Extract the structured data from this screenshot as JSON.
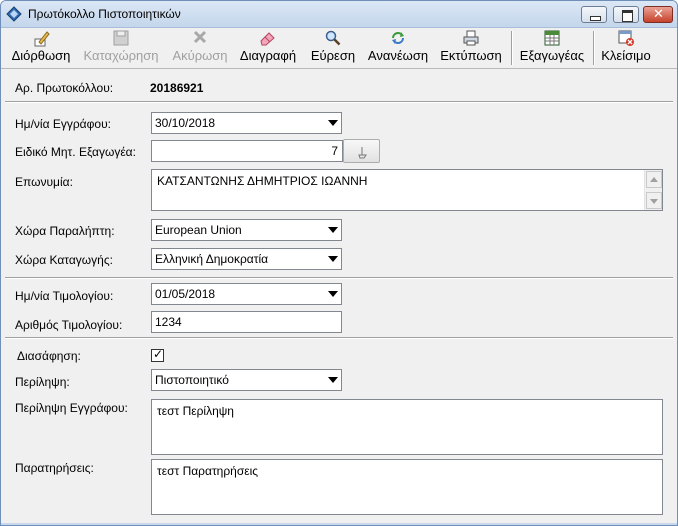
{
  "window": {
    "title": "Πρωτόκολλο Πιστοποιητικών"
  },
  "toolbar": {
    "buttons": [
      {
        "label": "Διόρθωση",
        "icon": "edit-pencil-icon",
        "enabled": true
      },
      {
        "label": "Καταχώρηση",
        "icon": "save-disk-icon",
        "enabled": false
      },
      {
        "label": "Ακύρωση",
        "icon": "cancel-x-icon",
        "enabled": false
      },
      {
        "label": "Διαγραφή",
        "icon": "eraser-icon",
        "enabled": true
      },
      {
        "label": "Εύρεση",
        "icon": "magnifier-icon",
        "enabled": true
      },
      {
        "label": "Ανανέωση",
        "icon": "refresh-icon",
        "enabled": true
      },
      {
        "label": "Εκτύπωση",
        "icon": "printer-icon",
        "enabled": true
      },
      {
        "label": "Εξαγωγέας",
        "icon": "spreadsheet-icon",
        "enabled": true
      },
      {
        "label": "Κλείσιμο",
        "icon": "close-window-icon",
        "enabled": true
      }
    ]
  },
  "form": {
    "protocol_label": "Αρ. Πρωτοκόλλου:",
    "protocol_value": "20186921",
    "doc_date_label": "Ημ/νία Εγγράφου:",
    "doc_date_value": "30/10/2018",
    "exporter_reg_label": "Ειδικό Μητ. Εξαγωγέα:",
    "exporter_reg_value": "7",
    "surname_label": "Επωνυμία:",
    "surname_value": "ΚΑΤΣΑΝΤΩΝΗΣ ΔΗΜΗΤΡΙΟΣ ΙΩΑΝΝΗ",
    "recipient_country_label": "Χώρα Παραλήπτη:",
    "recipient_country_value": "European Union",
    "origin_country_label": "Χώρα Καταγωγής:",
    "origin_country_value": "Ελληνική Δημοκρατία",
    "invoice_date_label": "Ημ/νία Τιμολογίου:",
    "invoice_date_value": "01/05/2018",
    "invoice_number_label": "Αριθμός Τιμολογίου:",
    "invoice_number_value": "1234",
    "clearance_label": "Διασάφηση:",
    "clearance_checked": true,
    "summary_label": "Περίληψη:",
    "summary_value": "Πιστοποιητικό",
    "doc_summary_label": "Περίληψη Εγγράφου:",
    "doc_summary_value": "τεστ Περίληψη",
    "remarks_label": "Παρατηρήσεις:",
    "remarks_value": "τεστ Παρατηρήσεις"
  },
  "colors": {
    "titlebar": "#c4d6ec",
    "window_bg": "#f0f0f0",
    "close_button": "#c6412b"
  }
}
